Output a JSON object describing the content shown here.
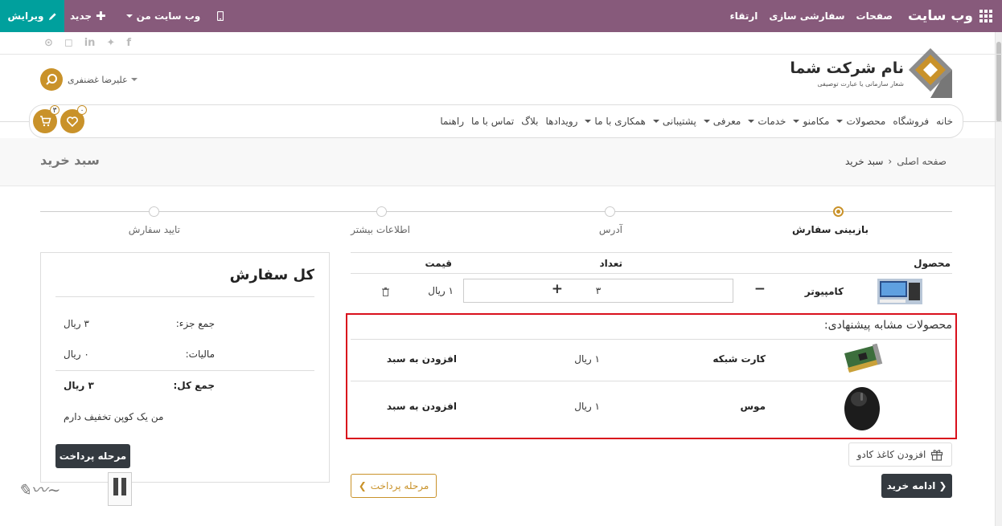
{
  "admin_bar": {
    "brand": "وب سایت",
    "menu": [
      "صفحات",
      "سفارشی سازی",
      "ارتقاء"
    ],
    "my_website": "وب سایت من",
    "new_label": "جدید",
    "edit_label": "ویرایش"
  },
  "header": {
    "logo_name": "نام شرکت شما",
    "logo_tagline": "شعار سازمانی یا عبارت توصیفی",
    "user_name": "علیرضا غضنفری",
    "cart_count": "۳",
    "wishlist_count": "۰"
  },
  "nav": {
    "items": [
      {
        "label": "خانه",
        "dropdown": false
      },
      {
        "label": "فروشگاه",
        "dropdown": false
      },
      {
        "label": "محصولات",
        "dropdown": true
      },
      {
        "label": "مکامنو",
        "dropdown": true
      },
      {
        "label": "خدمات",
        "dropdown": true
      },
      {
        "label": "معرفی",
        "dropdown": true
      },
      {
        "label": "پشتیبانی",
        "dropdown": true
      },
      {
        "label": "همکاری با ما",
        "dropdown": true
      },
      {
        "label": "رویدادها",
        "dropdown": false
      },
      {
        "label": "بلاگ",
        "dropdown": false
      },
      {
        "label": "تماس با ما",
        "dropdown": false
      },
      {
        "label": "راهنما",
        "dropdown": false
      }
    ]
  },
  "breadcrumb": {
    "home": "صفحه اصلی",
    "current": "سبد خرید",
    "page_title": "سبد خرید"
  },
  "wizard": {
    "steps": [
      "بازبینی سفارش",
      "آدرس",
      "اطلاعات بیشتر",
      "تایید سفارش"
    ],
    "active_step": 0
  },
  "cart": {
    "columns": {
      "product": "محصول",
      "quantity": "تعداد",
      "price": "قیمت"
    },
    "rows": [
      {
        "name": "کامپیوتر",
        "quantity": "۳",
        "price": "۱ ریال"
      }
    ]
  },
  "suggestions": {
    "title": "محصولات مشابه پیشنهادی:",
    "rows": [
      {
        "name": "کارت شبکه",
        "price": "۱ ریال",
        "action": "افزودن به سبد"
      },
      {
        "name": "موس",
        "price": "۱ ریال",
        "action": "افزودن به سبد"
      }
    ]
  },
  "actions": {
    "gift_wrap": "افزودن کاغذ کادو",
    "continue_shopping": "ادامه خرید",
    "checkout": "مرحله پرداخت"
  },
  "summary": {
    "title": "کل سفارش",
    "subtotal_label": "جمع جزء:",
    "subtotal_value": "۳ ریال",
    "tax_label": "مالیات:",
    "tax_value": "۰ ریال",
    "total_label": "جمع کل:",
    "total_value": "۳ ریال",
    "coupon_text": "من یک کوپن تخفیف دارم",
    "pay_button": "مرحله پرداخت"
  },
  "colors": {
    "admin_bar": "#875a7b",
    "edit_button": "#00a09d",
    "accent": "#c9922a",
    "highlight_border": "#d9101c",
    "dark_button": "#343a40"
  }
}
